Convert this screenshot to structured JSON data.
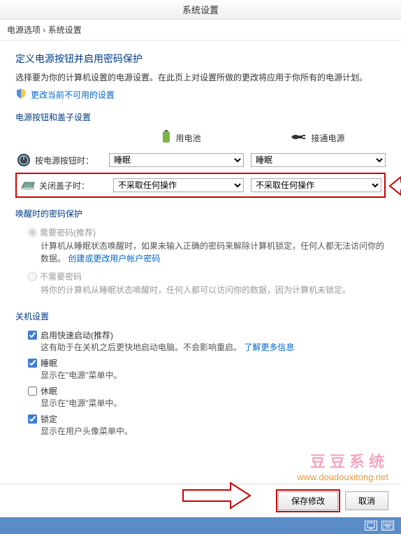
{
  "window_title": "系统设置",
  "breadcrumb": {
    "item1": "电源选项",
    "item2": "系统设置"
  },
  "heading": "定义电源按钮并启用密码保护",
  "description": "选择要为你的计算机设置的电源设置。在此页上对设置所做的更改将应用于你所有的电源计划。",
  "change_link": "更改当前不可用的设置",
  "section_power_button": "电源按钮和盖子设置",
  "col_battery": "用电池",
  "col_plugged": "接通电源",
  "power_button_row": {
    "label": "按电源按钮时：",
    "battery": "睡眠",
    "plugged": "睡眠"
  },
  "lid_row": {
    "label": "关闭盖子时：",
    "battery": "不采取任何操作",
    "plugged": "不采取任何操作"
  },
  "section_password": "唤醒时的密码保护",
  "pw_req": {
    "label": "需要密码(推荐)",
    "desc_part1": "计算机从睡眠状态唤醒时，如果未输入正确的密码来解除计算机锁定，任何人都无法访问你的数据。",
    "link": "创建或更改用户帐户密码"
  },
  "pw_noreq": {
    "label": "不需要密码",
    "desc": "将你的计算机从睡眠状态唤醒时，任何人都可以访问你的数据，因为计算机未锁定。"
  },
  "section_shutdown": "关机设置",
  "fast_startup": {
    "label": "启用快速启动(推荐)",
    "desc": "这有助于在关机之后更快地启动电脑。不会影响重启。",
    "link": "了解更多信息"
  },
  "sleep": {
    "label": "睡眠",
    "desc": "显示在\"电源\"菜单中。"
  },
  "hibernate": {
    "label": "休眠",
    "desc": "显示在\"电源\"菜单中。"
  },
  "lock": {
    "label": "锁定",
    "desc": "显示在用户头像菜单中。"
  },
  "watermark_cn": "豆豆系统",
  "watermark_url": "www.doudouxitong.net",
  "btn_save": "保存修改",
  "btn_cancel": "取消"
}
